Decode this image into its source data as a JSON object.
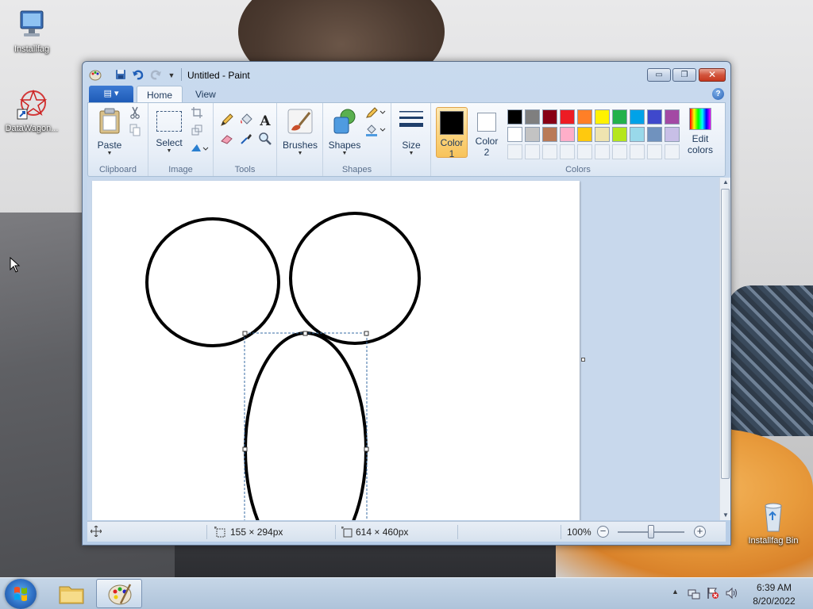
{
  "desktop": {
    "icons": [
      {
        "label": "Installfag"
      },
      {
        "label": "DataWagon..."
      },
      {
        "label": "Installfag Bin"
      }
    ]
  },
  "window": {
    "title": "Untitled - Paint",
    "minimize_symbol": "▭",
    "maximize_symbol": "❐",
    "close_symbol": "✕"
  },
  "ribbon": {
    "file_tab_symbol": "▤ ▾",
    "tabs": [
      {
        "label": "Home",
        "active": true
      },
      {
        "label": "View",
        "active": false
      }
    ],
    "help_symbol": "?",
    "groups": {
      "clipboard": {
        "label": "Clipboard",
        "paste_label": "Paste"
      },
      "image": {
        "label": "Image",
        "select_label": "Select"
      },
      "tools": {
        "label": "Tools"
      },
      "brushes": {
        "label": "Brushes"
      },
      "shapes": {
        "label": "Shapes",
        "shapes_label": "Shapes"
      },
      "size": {
        "label": "Size"
      },
      "colors": {
        "label": "Colors",
        "color1_label": "Color",
        "color1_num": "1",
        "color2_label": "Color",
        "color2_num": "2",
        "edit_label": "Edit",
        "edit_label2": "colors",
        "color1_value": "#000000",
        "color2_value": "#ffffff",
        "palette_row1": [
          "#000000",
          "#7f7f7f",
          "#880015",
          "#ed1c24",
          "#ff7f27",
          "#fff200",
          "#22b14c",
          "#00a2e8",
          "#3f48cc",
          "#a349a4"
        ],
        "palette_row2": [
          "#ffffff",
          "#c3c3c3",
          "#b97a57",
          "#ffaec9",
          "#ffc90e",
          "#efe4b0",
          "#b5e61d",
          "#99d9ea",
          "#7092be",
          "#c8bfe7"
        ]
      }
    }
  },
  "status": {
    "selection_size": "155 × 294px",
    "canvas_size": "614 × 460px",
    "zoom": "100%",
    "zoom_out": "−",
    "zoom_in": "+"
  },
  "taskbar": {
    "time": "6:39 AM",
    "date": "8/20/2022"
  }
}
